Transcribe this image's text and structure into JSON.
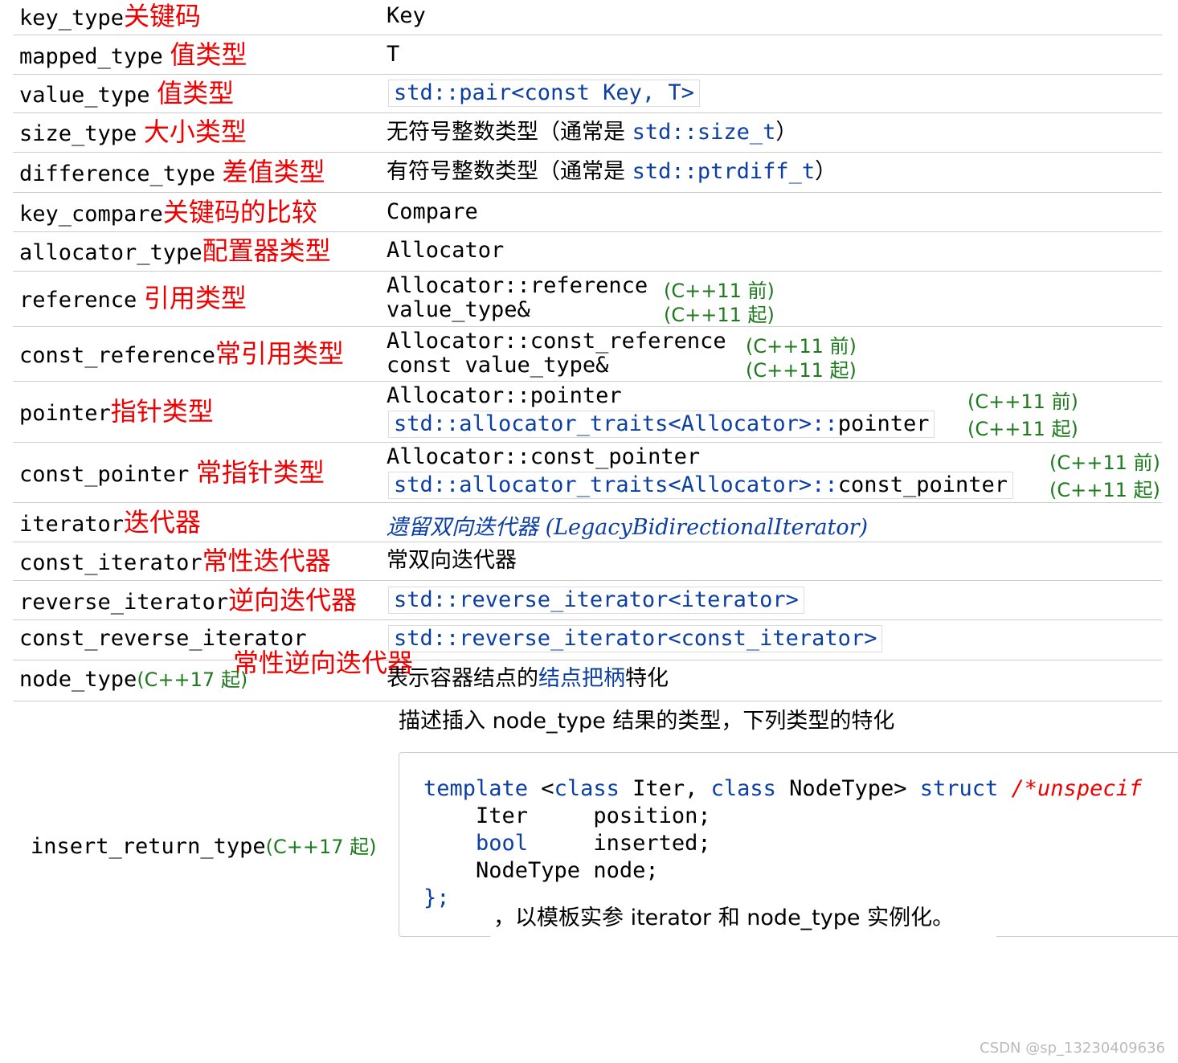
{
  "rows": [
    {
      "name": "key_type",
      "zh": "关键码",
      "value": "Key"
    },
    {
      "name": "mapped_type",
      "zh": "值类型",
      "value": "T"
    },
    {
      "name": "value_type",
      "zh": "值类型",
      "value": "std::pair<const Key, T>"
    },
    {
      "name": "size_type",
      "zh": "大小类型",
      "value_prefix": "无符号整数类型（通常是 ",
      "value_code": "std::size_t",
      "value_suffix": "）"
    },
    {
      "name": "difference_type",
      "zh": "差值类型",
      "value_prefix": "有符号整数类型（通常是 ",
      "value_code": "std::ptrdiff_t",
      "value_suffix": "）"
    },
    {
      "name": "key_compare",
      "zh": "关键码的比较",
      "value": "Compare"
    },
    {
      "name": "allocator_type",
      "zh": "配置器类型",
      "value": "Allocator"
    },
    {
      "name": "reference",
      "zh": "引用类型",
      "value1": "Allocator::reference",
      "ver1": "(C++11 前)",
      "value2": "value_type&",
      "ver2": "(C++11 起)"
    },
    {
      "name": "const_reference",
      "zh": "常引用类型",
      "value1": "Allocator::const_reference",
      "ver1": "(C++11 前)",
      "value2": "const value_type&",
      "ver2": "(C++11 起)"
    },
    {
      "name": "pointer",
      "zh": "指针类型",
      "value1": "Allocator::pointer",
      "ver1": "(C++11 前)",
      "value2_a": "std::allocator_traits<Allocator>::",
      "value2_b": "pointer",
      "ver2": "(C++11 起)"
    },
    {
      "name": "const_pointer",
      "zh": "常指针类型",
      "value1": "Allocator::const_pointer",
      "ver1": "(C++11 前)",
      "value2_a": "std::allocator_traits<Allocator>::",
      "value2_b": "const_pointer",
      "ver2": "(C++11 起)"
    },
    {
      "name": "iterator",
      "zh": "迭代器",
      "value": "遗留双向迭代器 (LegacyBidirectionalIterator)"
    },
    {
      "name": "const_iterator",
      "zh": "常性迭代器",
      "value": "常双向迭代器"
    },
    {
      "name": "reverse_iterator",
      "zh": "逆向迭代器",
      "value": "std::reverse_iterator<iterator>"
    },
    {
      "name": "const_reverse_iterator",
      "zh": "常性逆向迭代器",
      "value": "std::reverse_iterator<const_iterator>"
    },
    {
      "name": "node_type",
      "ver": "(C++17 起)",
      "value_prefix": "表示容器结点的",
      "value_link": "结点把柄",
      "value_suffix": "特化"
    },
    {
      "name": "insert_return_type",
      "ver": "(C++17 起)"
    }
  ],
  "insert_return": {
    "desc": "描述插入 node_type 结果的类型，下列类型的特化",
    "code_l1_kw1": "template",
    "code_l1_a": " <",
    "code_l1_kw2": "class",
    "code_l1_b": " Iter, ",
    "code_l1_kw3": "class",
    "code_l1_c": " NodeType> ",
    "code_l1_kw4": "struct",
    "code_l1_cm": " /*unspecif",
    "code_l2": "    Iter     position;",
    "code_l3_kw": "bool",
    "code_l3_rest": "     inserted;",
    "code_l4": "    NodeType node;",
    "code_l5": "};",
    "tail": "，以模板实参 iterator 和 node_type 实例化。"
  },
  "watermark": "CSDN @sp_13230409636"
}
